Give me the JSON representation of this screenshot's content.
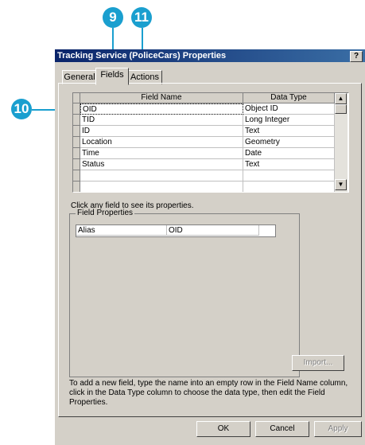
{
  "callouts": {
    "c9": "9",
    "c11": "11",
    "c10": "10"
  },
  "dialog": {
    "title": "Tracking Service (PoliceCars) Properties",
    "help": "?"
  },
  "tabs": [
    "General",
    "Fields",
    "Actions"
  ],
  "grid": {
    "columns": [
      "Field Name",
      "Data Type"
    ],
    "rows": [
      [
        "OID",
        "Object ID"
      ],
      [
        "TID",
        "Long Integer"
      ],
      [
        "ID",
        "Text"
      ],
      [
        "Location",
        "Geometry"
      ],
      [
        "Time",
        "Date"
      ],
      [
        "Status",
        "Text"
      ],
      [
        "",
        ""
      ]
    ]
  },
  "hint": "Click any field to see its properties.",
  "field_properties": {
    "legend": "Field Properties",
    "alias_label": "Alias",
    "alias_value": "OID"
  },
  "import_label": "Import...",
  "instructions": [
    "To add a new field, type the name into an empty row in the Field Name column,",
    "click in the Data Type column to choose the data type, then edit the Field",
    "Properties."
  ],
  "buttons": {
    "ok": "OK",
    "cancel": "Cancel",
    "apply": "Apply"
  }
}
